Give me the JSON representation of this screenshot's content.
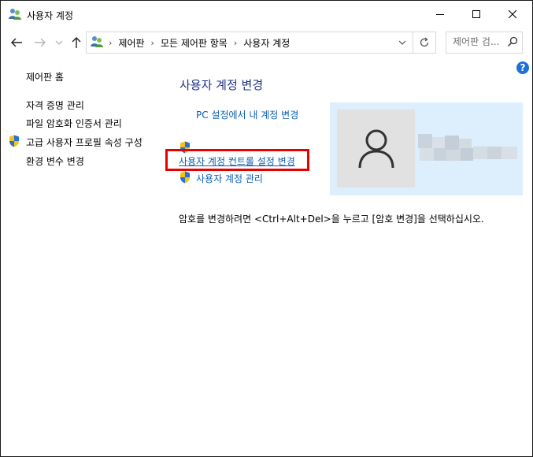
{
  "window": {
    "title": "사용자 계정",
    "controls": [
      "minimize",
      "maximize",
      "close"
    ]
  },
  "navigation": {
    "back_icon": "arrow-left-icon",
    "forward_icon": "arrow-right-icon",
    "recent_icon": "chevron-down-icon",
    "up_icon": "arrow-up-icon",
    "breadcrumbs": [
      "제어판",
      "모든 제어판 항목",
      "사용자 계정"
    ],
    "refresh_icon": "refresh-icon",
    "search_placeholder": "제어판 검..."
  },
  "help": {
    "label": "?"
  },
  "sidebar": {
    "home": "제어판 홈",
    "items": [
      {
        "label": "자격 증명 관리",
        "icon": null
      },
      {
        "label": "파일 암호화 인증서 관리",
        "icon": null
      },
      {
        "label": "고급 사용자 프로필 속성 구성",
        "icon": "shield-icon"
      },
      {
        "label": "환경 변수 변경",
        "icon": null
      }
    ]
  },
  "main": {
    "title": "사용자 계정 변경",
    "tasks": [
      {
        "label": "PC 설정에서 내 계정 변경",
        "icon": null
      },
      {
        "label": "사용자 계정 컨트롤 설정 변경",
        "icon": "shield-icon",
        "highlighted": true
      },
      {
        "label": "사용자 계정 관리",
        "icon": "shield-icon"
      }
    ],
    "note": "암호를 변경하려면 <Ctrl+Alt+Del>을 누르고 [암호 변경]을 선택하십시오."
  },
  "account": {
    "avatar_icon": "user-silhouette-icon",
    "name_blurred": true
  },
  "colors": {
    "link": "#0b5fb0",
    "title": "#1e3287",
    "account_panel": "#ddeefc",
    "highlight": "#e80000"
  }
}
